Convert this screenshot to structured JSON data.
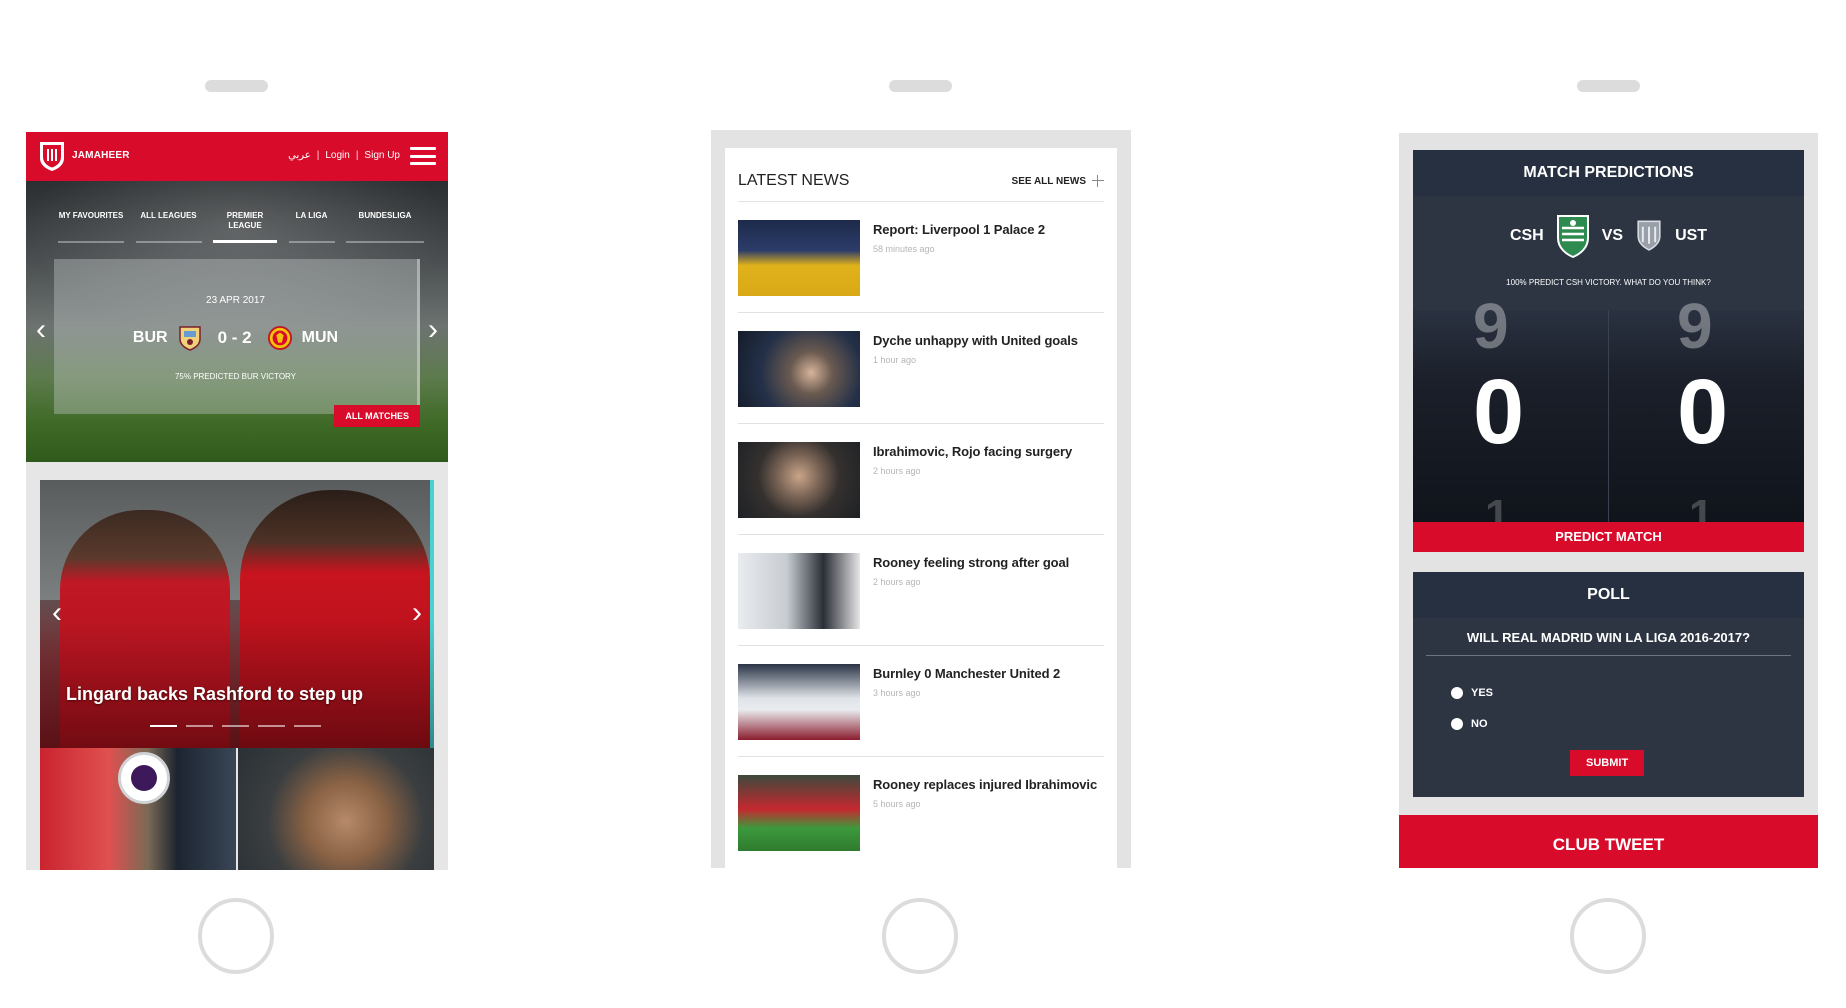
{
  "phone1": {
    "brand": "JAMAHEER",
    "header_links": {
      "arabic": "عربي",
      "sep1": "|",
      "login": "Login",
      "sep2": "|",
      "signup": "Sign Up"
    },
    "league_tabs": [
      {
        "label": "MY FAVOURITES"
      },
      {
        "label": "ALL LEAGUES"
      },
      {
        "label": "PREMIER LEAGUE"
      },
      {
        "label": "LA LIGA"
      },
      {
        "label": "BUNDESLIGA"
      }
    ],
    "active_tab": "PREMIER LEAGUE",
    "match": {
      "date": "23 APR 2017",
      "home": "BUR",
      "score": "0 - 2",
      "away": "MUN",
      "prediction": "75% PREDICTED BUR VICTORY"
    },
    "all_matches_label": "ALL MATCHES",
    "slider": {
      "title": "Lingard backs Rashford to step up",
      "dots": 5,
      "active_dot": 0
    },
    "accent_color": "#d90b2b"
  },
  "phone2": {
    "section_title": "LATEST NEWS",
    "see_all_label": "SEE ALL NEWS",
    "items": [
      {
        "headline": "Report: Liverpool 1 Palace 2",
        "time": "58 minutes ago"
      },
      {
        "headline": "Dyche unhappy with United goals",
        "time": "1 hour ago"
      },
      {
        "headline": "Ibrahimovic, Rojo facing surgery",
        "time": "2 hours ago"
      },
      {
        "headline": "Rooney feeling strong after goal",
        "time": "2 hours ago"
      },
      {
        "headline": "Burnley 0 Manchester United 2",
        "time": "3 hours ago"
      },
      {
        "headline": "Rooney replaces injured Ibrahimovic",
        "time": "5 hours ago"
      }
    ]
  },
  "phone3": {
    "predictions": {
      "title": "MATCH PREDICTIONS",
      "home": "CSH",
      "vs": "VS",
      "away": "UST",
      "note": "100% PREDICT CSH VICTORY. WHAT DO YOU THINK?",
      "home_score": "0",
      "away_score": "0",
      "prev_digit": "9",
      "next_digit": "1",
      "button": "PREDICT MATCH"
    },
    "poll": {
      "title": "POLL",
      "question": "WILL REAL MADRID WIN LA LIGA 2016-2017?",
      "options": [
        {
          "label": "YES"
        },
        {
          "label": "NO"
        }
      ],
      "submit": "SUBMIT"
    },
    "club_tweet": "CLUB TWEET"
  }
}
